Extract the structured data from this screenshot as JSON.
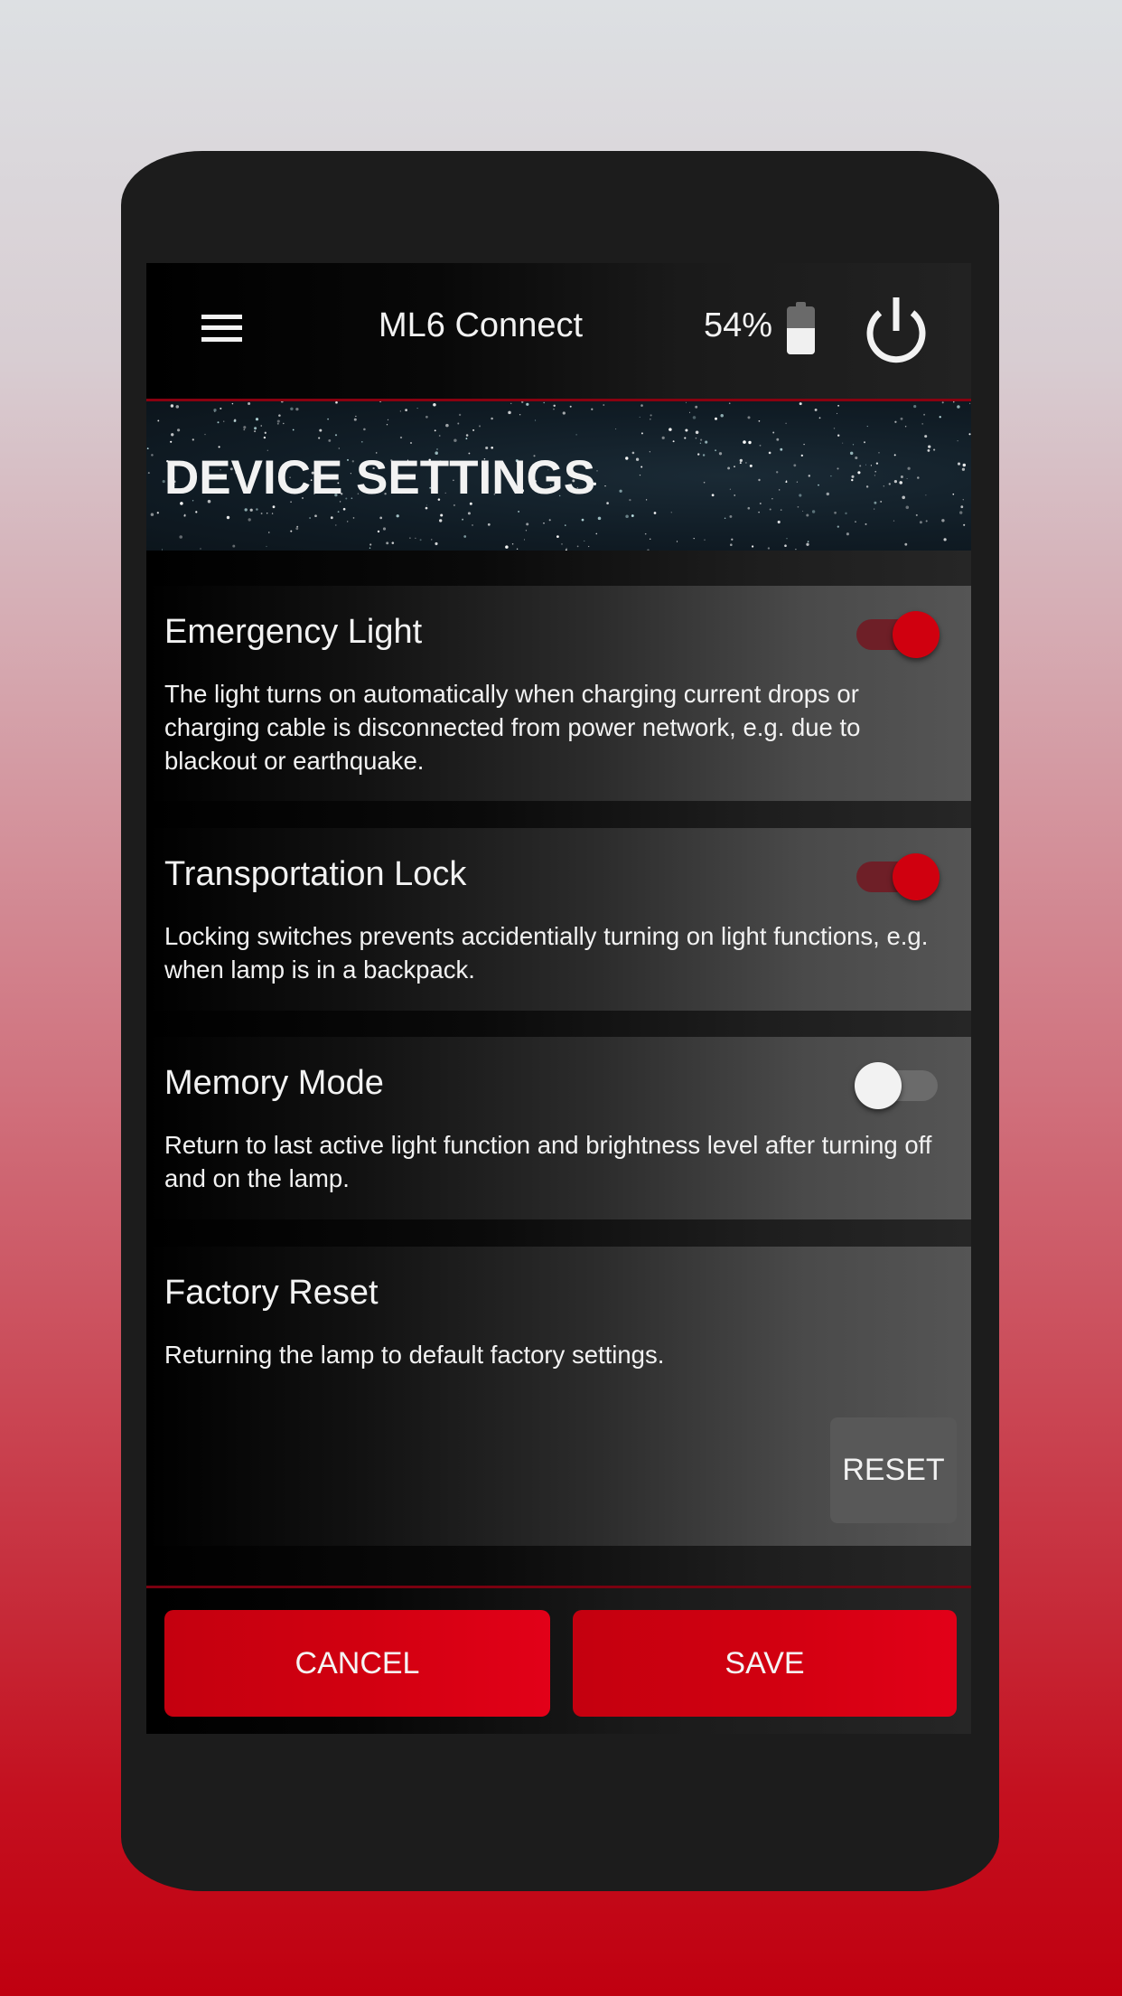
{
  "app_bar": {
    "menu_icon": "hamburger-menu-icon",
    "title": "ML6 Connect",
    "battery_percent_label": "54%",
    "battery_level": 0.54,
    "battery_icon": "battery-icon",
    "power_icon": "power-icon"
  },
  "banner": {
    "title": "DEVICE SETTINGS"
  },
  "settings": [
    {
      "title": "Emergency Light",
      "description": "The light turns on automatically when charging current drops or charging cable is disconnected from power network, e.g. due to blackout or earthquake.",
      "control": "toggle",
      "enabled": true
    },
    {
      "title": "Transportation Lock",
      "description": "Locking switches prevents accidentially turning on light functions, e.g. when lamp is in a backpack.",
      "control": "toggle",
      "enabled": true
    },
    {
      "title": "Memory Mode",
      "description": "Return to last active light function and brightness level after turning off and on the lamp.",
      "control": "toggle",
      "enabled": false
    },
    {
      "title": "Factory Reset",
      "description": "Returning the lamp to default factory settings.",
      "control": "button",
      "button_label": "RESET"
    }
  ],
  "footer": {
    "cancel_label": "CANCEL",
    "save_label": "SAVE"
  },
  "colors": {
    "accent_red": "#d0000f",
    "toggle_on_track": "#6e1f27",
    "toggle_off_knob": "#f2f2f2",
    "reset_button_bg": "#585858"
  }
}
